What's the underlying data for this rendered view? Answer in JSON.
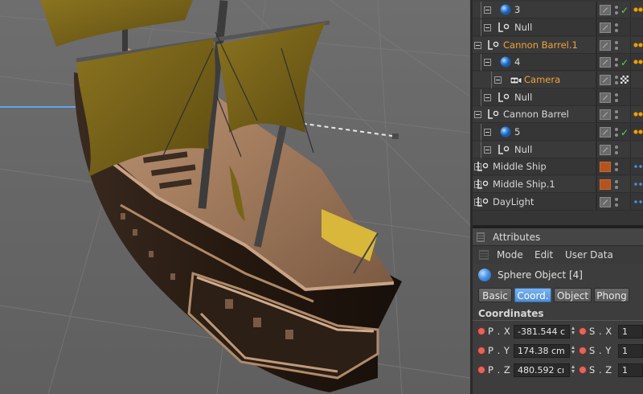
{
  "object_manager": {
    "rows": [
      {
        "name": "3",
        "color": "normal",
        "icon": "sphere-icon",
        "tag": "tag-box",
        "status": "check",
        "right": "orange-dots"
      },
      {
        "name": "Null",
        "color": "normal",
        "icon": "null-icon",
        "tag": "tag-box",
        "status": "none",
        "right": "none"
      },
      {
        "name": "Cannon Barrel.1",
        "color": "orange",
        "icon": "null-icon",
        "tag": "tag-box",
        "status": "none",
        "right": "orange-dots"
      },
      {
        "name": "4",
        "color": "normal",
        "icon": "sphere-icon",
        "tag": "tag-box",
        "status": "check",
        "right": "orange-dots"
      },
      {
        "name": "Camera",
        "color": "orange",
        "icon": "camera-icon",
        "tag": "tag-box",
        "status": "checker",
        "right": "none"
      },
      {
        "name": "Null",
        "color": "normal",
        "icon": "null-icon",
        "tag": "tag-box",
        "status": "none",
        "right": "none"
      },
      {
        "name": "Cannon Barrel",
        "color": "normal",
        "icon": "null-icon",
        "tag": "tag-box",
        "status": "none",
        "right": "orange-dots"
      },
      {
        "name": "5",
        "color": "normal",
        "icon": "sphere-icon",
        "tag": "tag-box",
        "status": "check",
        "right": "orange-dots"
      },
      {
        "name": "Null",
        "color": "normal",
        "icon": "null-icon",
        "tag": "tag-box",
        "status": "none",
        "right": "none"
      },
      {
        "name": "Middle Ship",
        "color": "normal",
        "icon": "null-icon",
        "tag": "material",
        "status": "none",
        "right": "blue-dots"
      },
      {
        "name": "Middle Ship.1",
        "color": "normal",
        "icon": "null-icon",
        "tag": "material",
        "status": "none",
        "right": "blue-dots"
      },
      {
        "name": "DayLight",
        "color": "normal",
        "icon": "null-icon",
        "tag": "tag-box",
        "status": "none",
        "right": "blue-dots"
      }
    ]
  },
  "attributes": {
    "title": "Attributes",
    "menu": {
      "mode": "Mode",
      "edit": "Edit",
      "user_data": "User Data"
    },
    "object_title": "Sphere Object [4]",
    "tabs": {
      "basic": "Basic",
      "coord": "Coord.",
      "object": "Object",
      "phong": "Phong"
    },
    "active_tab": "coord",
    "section": "Coordinates",
    "coords": [
      {
        "p_label": "P . X",
        "p_value": "-381.544 c",
        "s_label": "S . X",
        "s_value": "1"
      },
      {
        "p_label": "P . Y",
        "p_value": "174.38 cm",
        "s_label": "S . Y",
        "s_value": "1"
      },
      {
        "p_label": "P . Z",
        "p_value": "480.592 cı",
        "s_label": "S . Z",
        "s_value": "1"
      }
    ]
  },
  "colors": {
    "accent": "#f2a23a",
    "active_tab": "#5b9be0",
    "check_green": "#5fd35f",
    "material_orange": "#b3531f",
    "sail": "#7a6418",
    "hull_dark": "#2a1e17",
    "deck": "#a47b5e"
  }
}
